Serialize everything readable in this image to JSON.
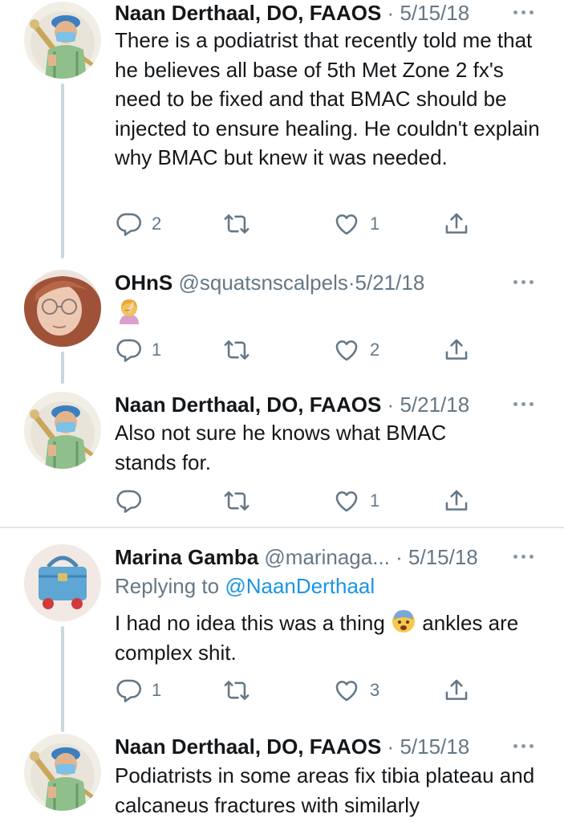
{
  "colors": {
    "text": "#14171a",
    "secondary": "#657786",
    "link": "#1b95e0",
    "thread_line": "#ccd6dd",
    "divider": "#e1e8ed"
  },
  "tweets": [
    {
      "name": "Naan Derthaal, DO, FAAOS",
      "sep": "·",
      "date": "5/15/18",
      "body": "There is a podiatrist that recently told me that he believes all base of 5th Met Zone 2 fx's need to be fixed and that BMAC should be injected to ensure healing. He couldn't explain why BMAC but knew it was needed.",
      "replies": "2",
      "retweets": "",
      "likes": "1"
    },
    {
      "name": "OHnS",
      "handle": "@squatsnscalpels",
      "sep": "·",
      "date": "5/21/18",
      "emoji": "woman-facepalming-emoji",
      "replies": "1",
      "retweets": "",
      "likes": "2"
    },
    {
      "name": "Naan Derthaal, DO, FAAOS",
      "sep": "·",
      "date": "5/21/18",
      "body": "Also not sure he knows what BMAC stands for.",
      "replies": "",
      "retweets": "",
      "likes": "1"
    },
    {
      "name": "Marina Gamba",
      "handle": "@marinaga...",
      "sep": "·",
      "date": "5/15/18",
      "replying_label": "Replying to",
      "replying_mention": "@NaanDerthaal",
      "body_before": "I had no idea this was a thing",
      "body_after": "ankles are complex shit.",
      "emoji": "fearful-face-emoji",
      "replies": "1",
      "retweets": "",
      "likes": "3"
    },
    {
      "name": "Naan Derthaal, DO, FAAOS",
      "sep": "·",
      "date": "5/15/18",
      "body": "Podiatrists in some areas fix tibia plateau and calcaneus fractures with similarly"
    }
  ]
}
